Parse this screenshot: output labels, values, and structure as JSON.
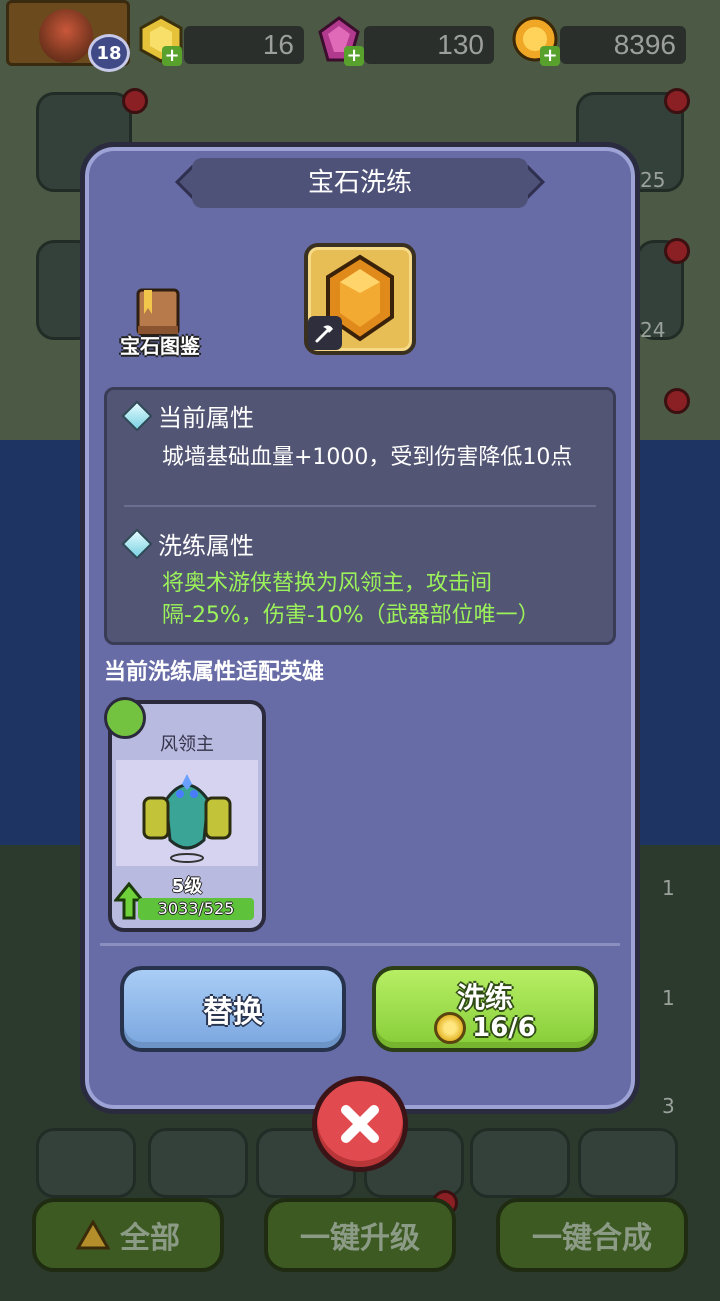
{
  "hud": {
    "player_level": "18",
    "energy": "16",
    "gems": "130",
    "gold": "8396"
  },
  "background": {
    "tile_numbers": [
      "25",
      "24",
      "1",
      "1",
      "3"
    ]
  },
  "bottom_bar": {
    "all_label": "全部",
    "upgrade_all_label": "一键升级",
    "merge_all_label": "一键合成"
  },
  "modal": {
    "title": "宝石洗练",
    "codex_label": "宝石图鉴",
    "current_attr": {
      "heading": "当前属性",
      "text": "城墙基础血量+1000，受到伤害降低10点"
    },
    "refine_attr": {
      "heading": "洗练属性",
      "text": "将奥术游侠替换为风领主，攻击间隔-25%，伤害-10%（武器部位唯一）"
    },
    "fit_heroes_label": "当前洗练属性适配英雄",
    "hero": {
      "name": "风领主",
      "level": "5级",
      "xp_text": "3033/525",
      "xp_fill": 1.0
    },
    "replace_button": "替换",
    "refine_button": "洗练",
    "refine_cost": "16/6"
  },
  "colors": {
    "modal_bg": "#676ca6",
    "refine_text": "#9cf25a",
    "replace_button": "#8fb8ea",
    "refine_button": "#9edc4a",
    "close_button": "#e14a4e"
  },
  "icons": {
    "energy": "hexagon-coin-icon",
    "gems": "gem-icon",
    "gold": "gold-coin-icon",
    "codex": "book-icon",
    "gem_slot": "amber-gem-icon",
    "hammer": "hammer-icon",
    "attr_bullet": "diamond-icon",
    "hero_element": "wind-icon",
    "close": "close-icon"
  }
}
